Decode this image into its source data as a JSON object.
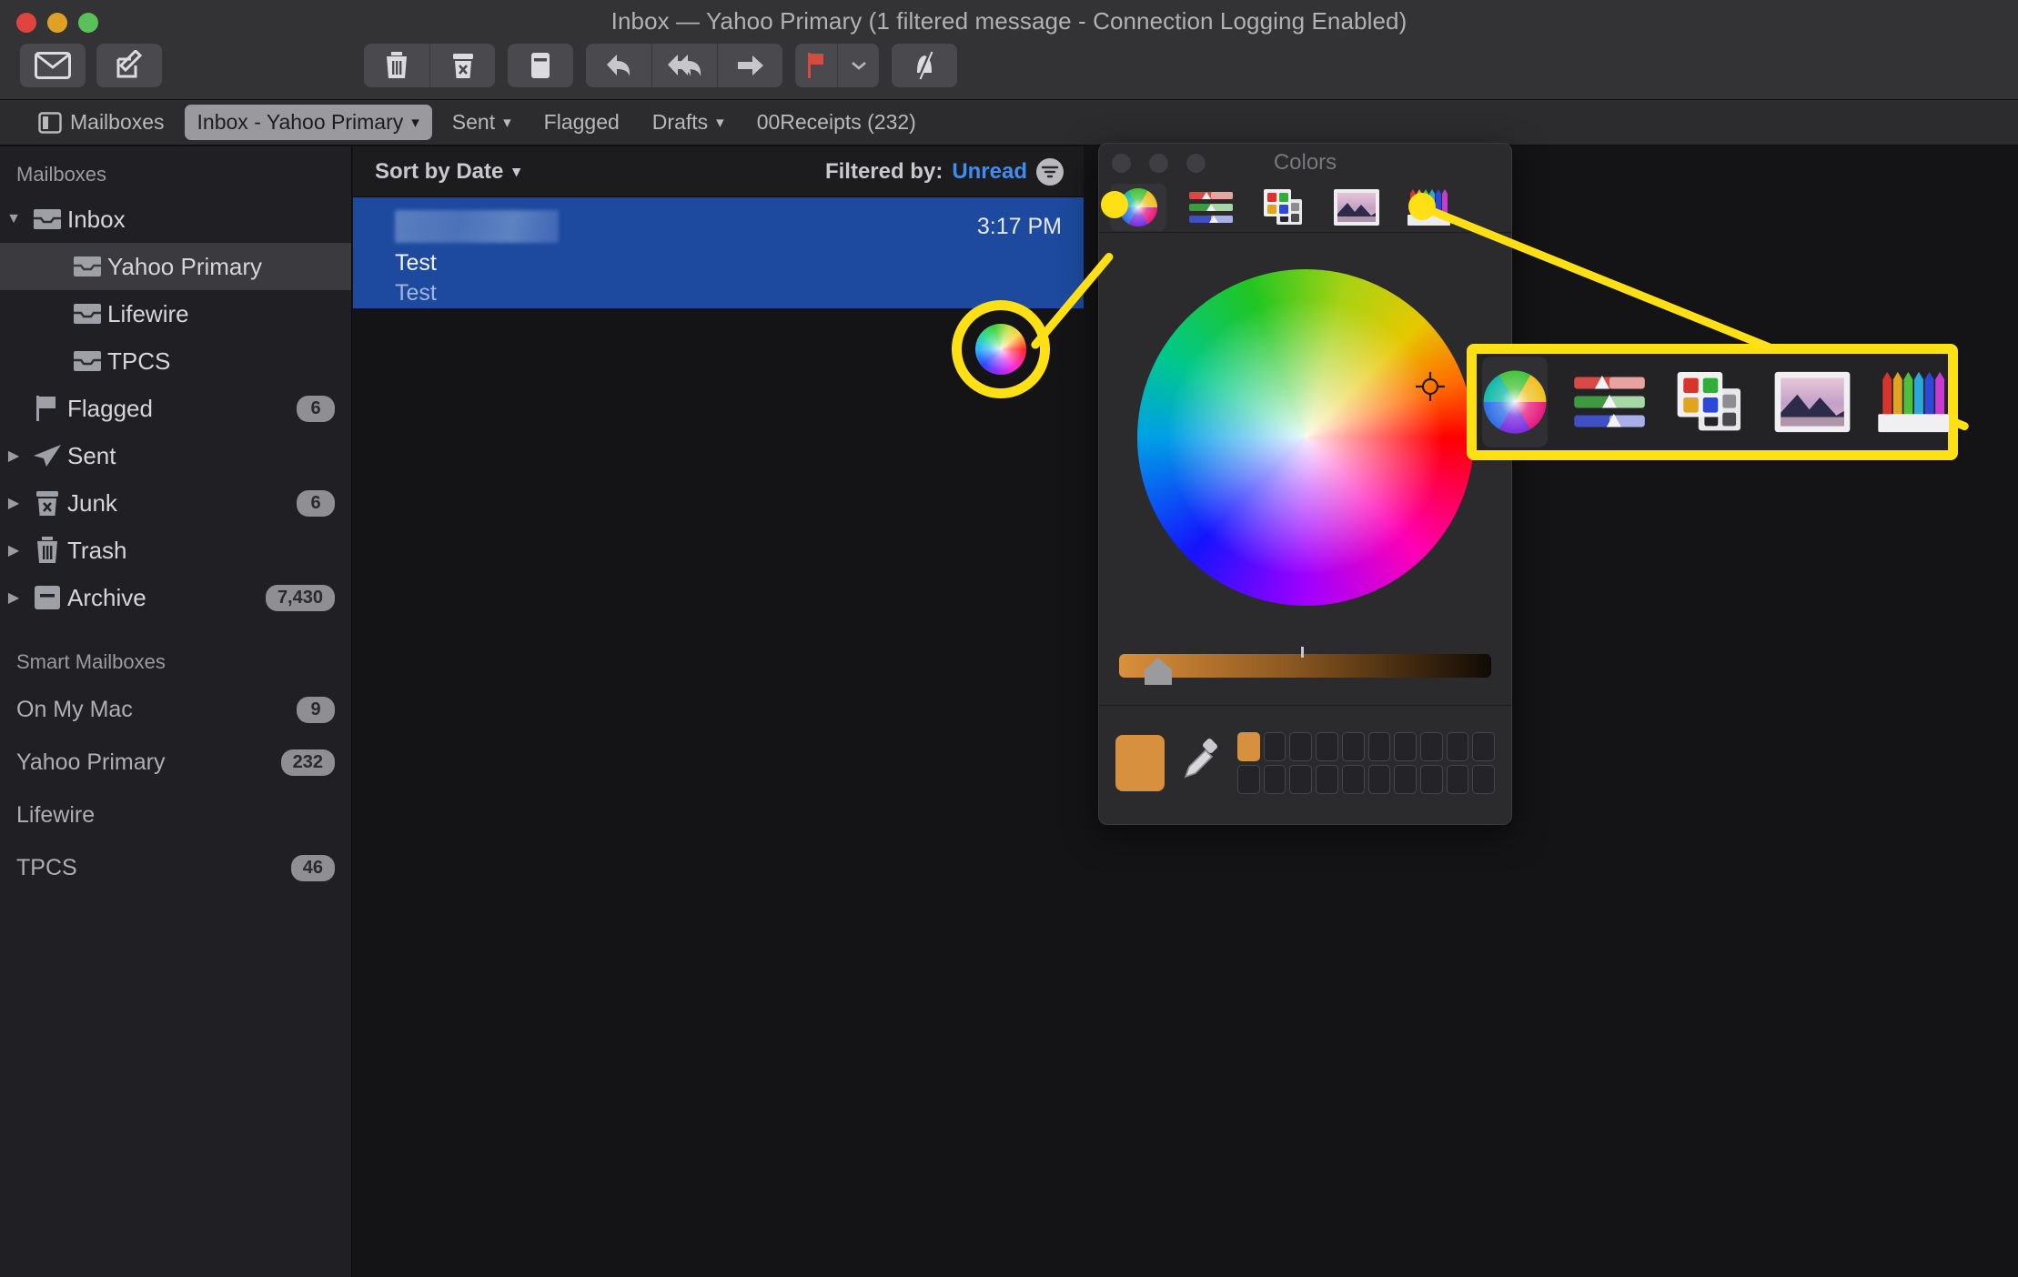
{
  "window": {
    "title": "Inbox — Yahoo Primary (1 filtered message - Connection Logging Enabled)",
    "traffic_lights": [
      "close",
      "minimize",
      "zoom"
    ]
  },
  "toolbar": {
    "buttons": [
      {
        "name": "get-mail",
        "icon": "envelope-icon",
        "label": "Get Mail"
      },
      {
        "name": "compose",
        "icon": "compose-icon",
        "label": "New Message"
      },
      {
        "name": "delete",
        "icon": "trash-icon",
        "label": "Delete"
      },
      {
        "name": "junk",
        "icon": "junk-icon",
        "label": "Mark as Junk"
      },
      {
        "name": "archive",
        "icon": "archive-icon",
        "label": "Archive"
      },
      {
        "name": "reply",
        "icon": "reply-icon",
        "label": "Reply"
      },
      {
        "name": "reply-all",
        "icon": "reply-all-icon",
        "label": "Reply All"
      },
      {
        "name": "forward",
        "icon": "forward-icon",
        "label": "Forward"
      },
      {
        "name": "flag",
        "icon": "flag-icon",
        "label": "Flag"
      },
      {
        "name": "flag-menu",
        "icon": "chevron-down-icon",
        "label": "Flag Options"
      },
      {
        "name": "mute",
        "icon": "mute-bell-icon",
        "label": "Mute"
      }
    ]
  },
  "favorites_bar": {
    "mailboxes_label": "Mailboxes",
    "items": [
      {
        "label": "Inbox - Yahoo Primary",
        "has_chevron": true,
        "active": true
      },
      {
        "label": "Sent",
        "has_chevron": true,
        "active": false
      },
      {
        "label": "Flagged",
        "has_chevron": false,
        "active": false
      },
      {
        "label": "Drafts",
        "has_chevron": true,
        "active": false
      },
      {
        "label": "00Receipts (232)",
        "has_chevron": false,
        "active": false
      }
    ]
  },
  "sidebar": {
    "section_mailboxes": "Mailboxes",
    "section_smart": "Smart Mailboxes",
    "mailboxes": [
      {
        "label": "Inbox",
        "icon": "inbox-icon",
        "disclosure": "down",
        "indent": 0,
        "badge": "",
        "selected": false
      },
      {
        "label": "Yahoo Primary",
        "icon": "inbox-icon",
        "disclosure": "",
        "indent": 1,
        "badge": "",
        "selected": true
      },
      {
        "label": "Lifewire",
        "icon": "inbox-icon",
        "disclosure": "",
        "indent": 1,
        "badge": "",
        "selected": false
      },
      {
        "label": "TPCS",
        "icon": "inbox-icon",
        "disclosure": "",
        "indent": 1,
        "badge": "",
        "selected": false
      },
      {
        "label": "Flagged",
        "icon": "flag-icon",
        "disclosure": "",
        "indent": 0,
        "badge": "6",
        "selected": false
      },
      {
        "label": "Sent",
        "icon": "sent-icon",
        "disclosure": "right",
        "indent": 0,
        "badge": "",
        "selected": false
      },
      {
        "label": "Junk",
        "icon": "junk-icon",
        "disclosure": "right",
        "indent": 0,
        "badge": "6",
        "selected": false
      },
      {
        "label": "Trash",
        "icon": "trash-icon",
        "disclosure": "right",
        "indent": 0,
        "badge": "",
        "selected": false
      },
      {
        "label": "Archive",
        "icon": "archive-icon",
        "disclosure": "right",
        "indent": 0,
        "badge": "7,430",
        "selected": false
      }
    ],
    "smart_mailboxes": [
      {
        "label": "On My Mac",
        "badge": "9"
      },
      {
        "label": "Yahoo Primary",
        "badge": "232"
      },
      {
        "label": "Lifewire",
        "badge": ""
      },
      {
        "label": "TPCS",
        "badge": "46"
      }
    ]
  },
  "message_list": {
    "sort_label": "Sort by Date",
    "filter_label": "Filtered by:",
    "filter_value": "Unread",
    "filter_icon": "filter-icon",
    "messages": [
      {
        "sender_redacted": true,
        "time": "3:17 PM",
        "subject": "Test",
        "preview": "Test",
        "selected": true
      }
    ]
  },
  "colors_panel": {
    "title": "Colors",
    "window_dots": 3,
    "tabs": [
      {
        "name": "color-wheel-tab",
        "icon": "color-wheel-icon",
        "active": true
      },
      {
        "name": "color-sliders-tab",
        "icon": "sliders-icon",
        "active": false
      },
      {
        "name": "color-palettes-tab",
        "icon": "palettes-icon",
        "active": false
      },
      {
        "name": "image-palettes-tab",
        "icon": "image-icon",
        "active": false
      },
      {
        "name": "pencils-tab",
        "icon": "pencils-icon",
        "active": false
      }
    ],
    "selected_color": "#d7913e",
    "brightness_slider": {
      "value_position_pct": 8,
      "tick_position_pct": 49
    },
    "swatch_grid": {
      "columns": 10,
      "rows": 2,
      "filled": [
        0
      ]
    },
    "eyedropper_icon": "eyedropper-icon",
    "wheel_cursor_icon": "crosshair-icon"
  },
  "annotations": {
    "highlight_color": "#ffe014",
    "circle_target": "color-wheel-tab-icon",
    "box_target": "colors-panel-tab-bar"
  }
}
